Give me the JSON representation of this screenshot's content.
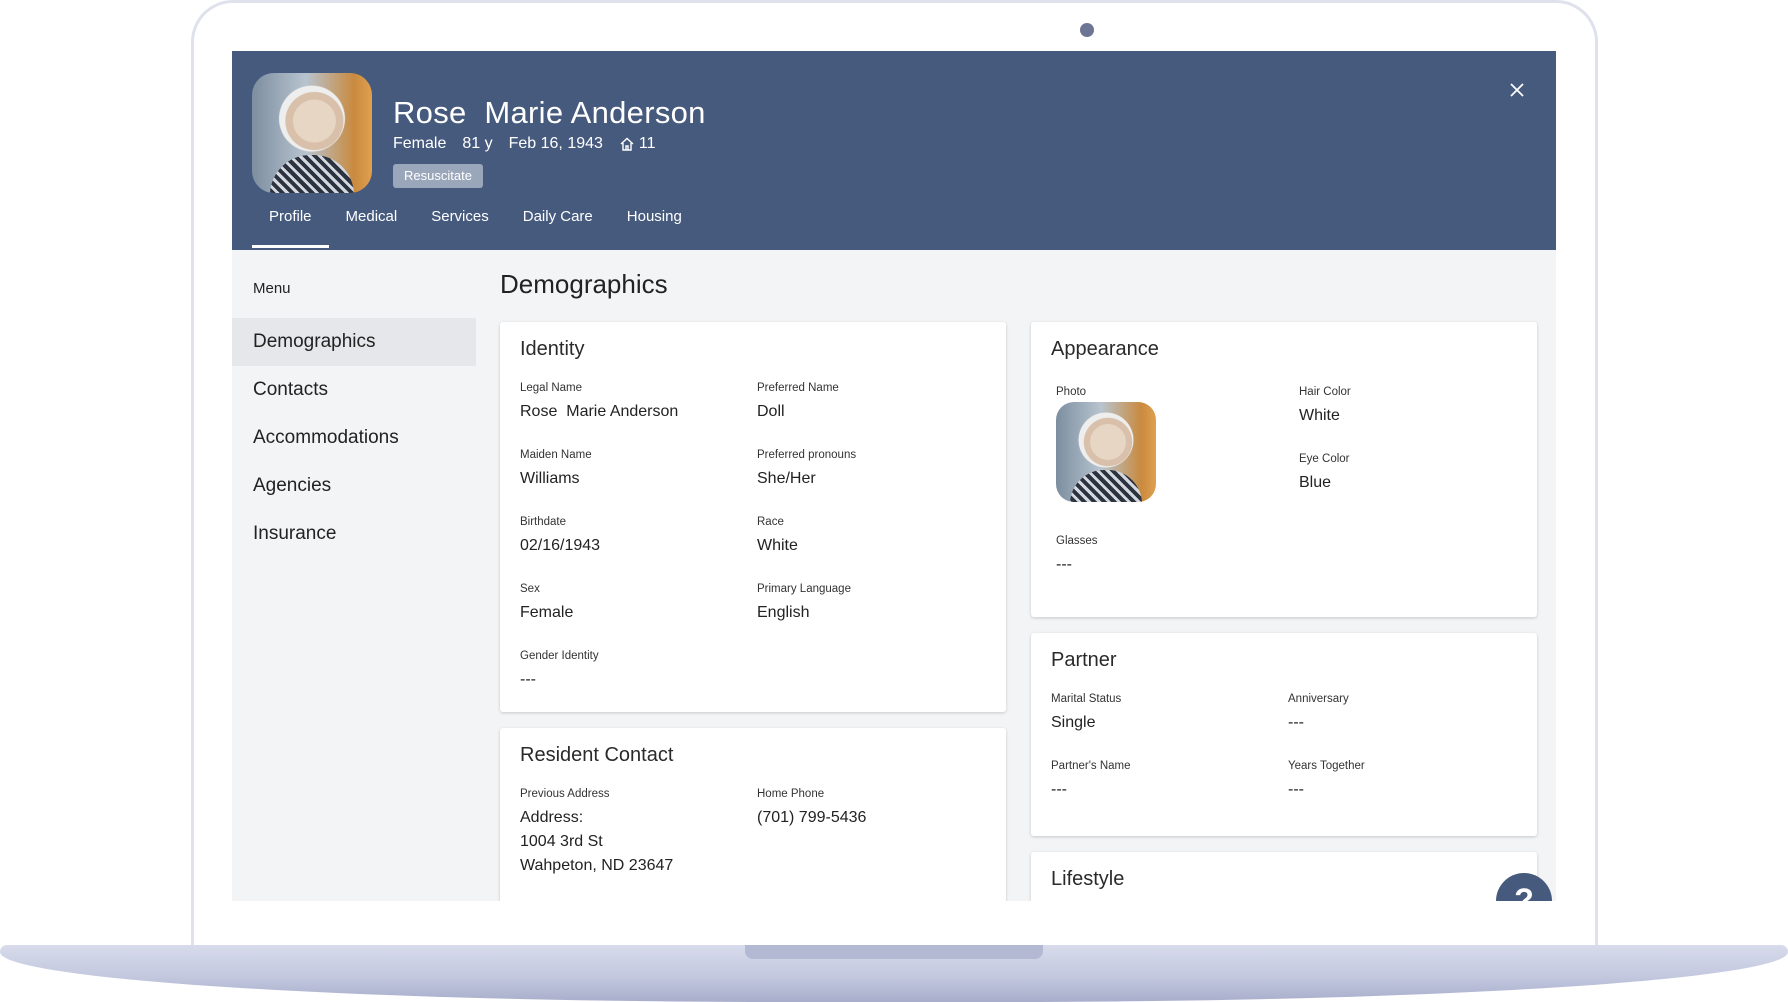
{
  "resident": {
    "name": "Rose  Marie Anderson",
    "sex": "Female",
    "age": "81 y",
    "birth": "Feb 16, 1943",
    "room": "11",
    "code_status": "Resuscitate"
  },
  "tabs": [
    {
      "label": "Profile"
    },
    {
      "label": "Medical"
    },
    {
      "label": "Services"
    },
    {
      "label": "Daily Care"
    },
    {
      "label": "Housing"
    }
  ],
  "menu": {
    "title": "Menu",
    "items": [
      {
        "label": "Demographics"
      },
      {
        "label": "Contacts"
      },
      {
        "label": "Accommodations"
      },
      {
        "label": "Agencies"
      },
      {
        "label": "Insurance"
      }
    ]
  },
  "page_title": "Demographics",
  "identity": {
    "title": "Identity",
    "legal_name_label": "Legal Name",
    "legal_name": "Rose  Marie Anderson",
    "preferred_name_label": "Preferred Name",
    "preferred_name": "Doll",
    "maiden_name_label": "Maiden Name",
    "maiden_name": "Williams",
    "pronouns_label": "Preferred pronouns",
    "pronouns": "She/Her",
    "birthdate_label": "Birthdate",
    "birthdate": "02/16/1943",
    "race_label": "Race",
    "race": "White",
    "sex_label": "Sex",
    "sex": "Female",
    "language_label": "Primary Language",
    "language": "English",
    "gender_label": "Gender Identity",
    "gender": "---"
  },
  "contact": {
    "title": "Resident Contact",
    "address_label": "Previous Address",
    "address": "Address:\n1004 3rd St\nWahpeton, ND 23647",
    "phone_label": "Home Phone",
    "phone": "(701) 799-5436"
  },
  "appearance": {
    "title": "Appearance",
    "photo_label": "Photo",
    "hair_label": "Hair Color",
    "hair": "White",
    "eye_label": "Eye Color",
    "eye": "Blue",
    "glasses_label": "Glasses",
    "glasses": "---"
  },
  "partner": {
    "title": "Partner",
    "marital_label": "Marital Status",
    "marital": "Single",
    "anniversary_label": "Anniversary",
    "anniversary": "---",
    "partner_name_label": "Partner's Name",
    "partner_name": "---",
    "years_label": "Years Together",
    "years": "---"
  },
  "lifestyle": {
    "title": "Lifestyle"
  },
  "help": {
    "label": "?"
  },
  "colors": {
    "header": "#465a7d",
    "background": "#f3f4f6",
    "active_menu": "#e6e7ea"
  }
}
